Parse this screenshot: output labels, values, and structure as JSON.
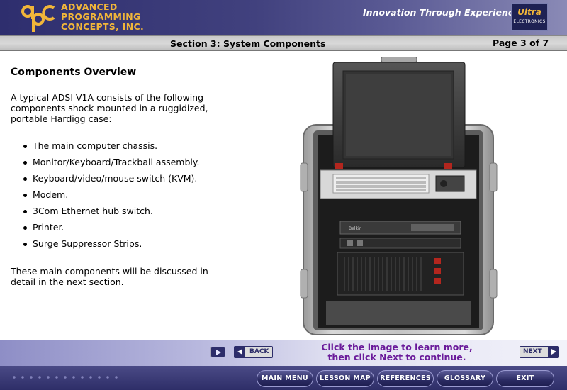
{
  "header": {
    "company_lines": [
      "ADVANCED",
      "PROGRAMMING",
      "CONCEPTS, INC."
    ],
    "tagline": "Innovation Through Experience",
    "partner_logo": {
      "name": "Ultra",
      "sub": "ELECTRONICS"
    }
  },
  "section_bar": {
    "title": "Section 3: System Components",
    "page": "Page 3 of 7"
  },
  "content": {
    "heading": "Components Overview",
    "intro": "A typical ADSI V1A consists of the following components shock mounted in a ruggidized, portable Hardigg case:",
    "bullets": [
      "The main computer chassis.",
      "Monitor/Keyboard/Trackball assembly.",
      "Keyboard/video/mouse switch (KVM).",
      "Modem.",
      "3Com Ethernet hub switch.",
      "Printer.",
      "Surge Suppressor Strips."
    ],
    "outro": "These main components will be discussed in detail in the next section."
  },
  "nav": {
    "back_label": "BACK",
    "next_label": "NEXT",
    "instruction_line1": "Click the image to learn more,",
    "instruction_line2": "then click Next to continue."
  },
  "menu": {
    "main_menu": "MAIN MENU",
    "lesson_map": "LESSON MAP",
    "references": "REFERENCES",
    "glossary": "GLOSSARY",
    "exit": "EXIT"
  },
  "colors": {
    "header_bg": "#2e2e6e",
    "company_text": "#f1b63a",
    "instruction_text": "#6a1a9a",
    "bottom_bar": "#2e2e68"
  }
}
